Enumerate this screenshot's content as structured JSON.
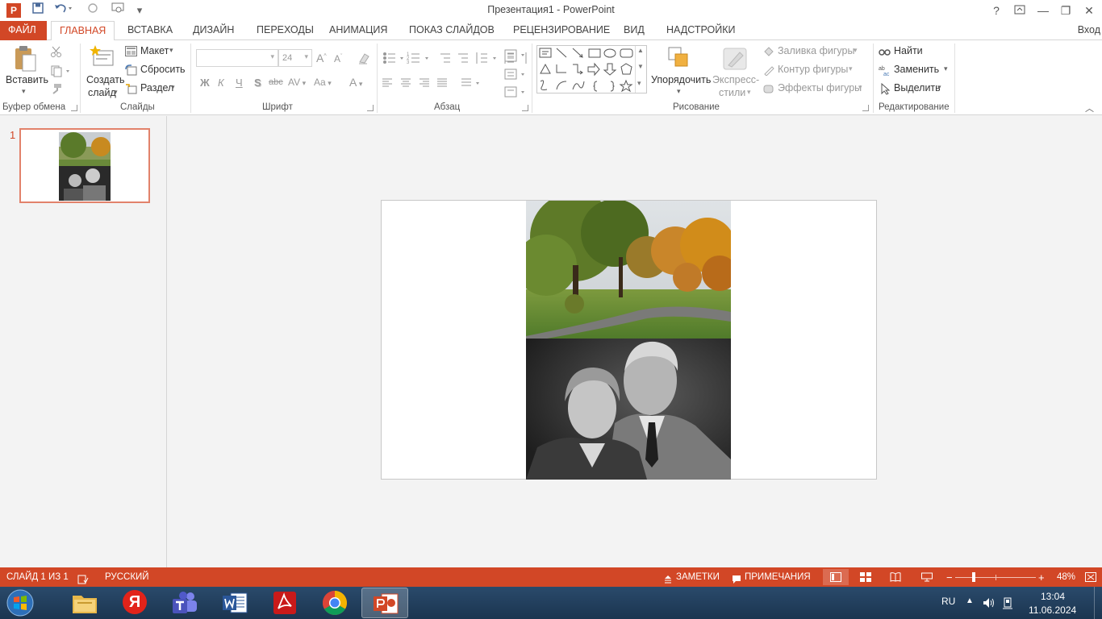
{
  "window": {
    "title": "Презентация1 - PowerPoint",
    "help": "?",
    "min": "—",
    "restore": "❐",
    "close": "✕"
  },
  "tabs": [
    "ФАЙЛ",
    "ГЛАВНАЯ",
    "ВСТАВКА",
    "ДИЗАЙН",
    "ПЕРЕХОДЫ",
    "АНИМАЦИЯ",
    "ПОКАЗ СЛАЙДОВ",
    "РЕЦЕНЗИРОВАНИЕ",
    "ВИД",
    "НАДСТРОЙКИ"
  ],
  "signin": "Вход",
  "ribbon": {
    "clipboard": {
      "label": "Буфер обмена",
      "paste": "Вставить"
    },
    "slides": {
      "label": "Слайды",
      "new_slide_1": "Создать",
      "new_slide_2": "слайд",
      "layout": "Макет",
      "reset": "Сбросить",
      "section": "Раздел"
    },
    "font": {
      "label": "Шрифт",
      "size": "24",
      "bold": "Ж",
      "italic": "К",
      "underline": "Ч",
      "shadow": "S",
      "strike": "abc",
      "spacing": "AV",
      "case": "Aa",
      "color": "A"
    },
    "paragraph": {
      "label": "Абзац"
    },
    "drawing": {
      "label": "Рисование",
      "arrange": "Упорядочить",
      "quick_styles_1": "Экспресс-",
      "quick_styles_2": "стили",
      "fill": "Заливка фигуры",
      "outline": "Контур фигуры",
      "effects": "Эффекты фигуры"
    },
    "editing": {
      "label": "Редактирование",
      "find": "Найти",
      "replace": "Заменить",
      "select": "Выделить"
    }
  },
  "slides_panel": {
    "number": "1"
  },
  "status": {
    "slide": "СЛАЙД 1 ИЗ 1",
    "language": "РУССКИЙ",
    "notes": "ЗАМЕТКИ",
    "comments": "ПРИМЕЧАНИЯ",
    "zoom": "48%"
  },
  "taskbar": {
    "lang": "RU",
    "time": "13:04",
    "date": "11.06.2024",
    "yandex": "Я"
  },
  "colors": {
    "accent": "#d24726",
    "taskbar": "#1f3b58"
  }
}
